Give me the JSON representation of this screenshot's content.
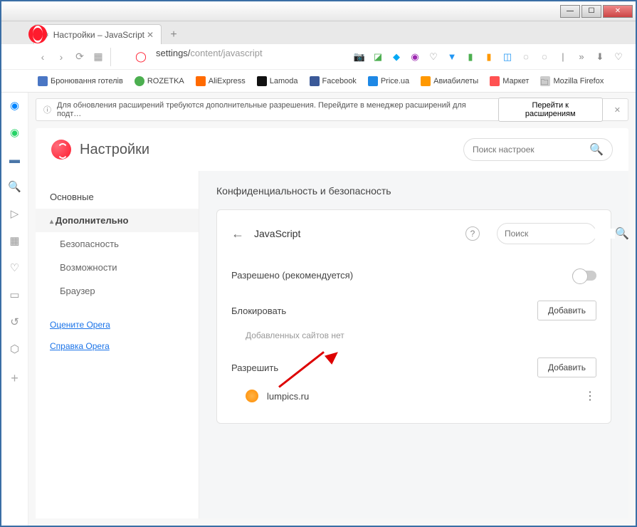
{
  "window": {
    "tab_title": "Настройки – JavaScript"
  },
  "address": {
    "prefix": "settings/",
    "path": "content/javascript"
  },
  "bookmarks": [
    {
      "label": "Бронювання готелів",
      "color": "#4a76c4"
    },
    {
      "label": "ROZETKA",
      "color": "#4caf50"
    },
    {
      "label": "AliExpress",
      "color": "#ff6a00"
    },
    {
      "label": "Lamoda",
      "color": "#111"
    },
    {
      "label": "Facebook",
      "color": "#3b5998"
    },
    {
      "label": "Price.ua",
      "color": "#1e88e5"
    },
    {
      "label": "Авиабилеты",
      "color": "#ff9800"
    },
    {
      "label": "Маркет",
      "color": "#ff5252"
    },
    {
      "label": "Mozilla Firefox",
      "color": "#ccc"
    }
  ],
  "notif": {
    "text": "Для обновления расширений требуются дополнительные разрешения. Перейдите в менеджер расширений для подт…",
    "button": "Перейти к расширениям"
  },
  "header": {
    "title": "Настройки",
    "search_placeholder": "Поиск настроек"
  },
  "sidenav": {
    "basic": "Основные",
    "advanced": "Дополнительно",
    "security": "Безопасность",
    "features": "Возможности",
    "browser": "Браузер",
    "rate": "Оцените Opera",
    "help": "Справка Opera"
  },
  "panel": {
    "section_title": "Конфиденциальность и безопасность",
    "page_title": "JavaScript",
    "search_placeholder": "Поиск",
    "allowed_label": "Разрешено (рекомендуется)",
    "block_label": "Блокировать",
    "add_button": "Добавить",
    "empty_text": "Добавленных сайтов нет",
    "allow_label": "Разрешить",
    "site": "lumpics.ru"
  }
}
